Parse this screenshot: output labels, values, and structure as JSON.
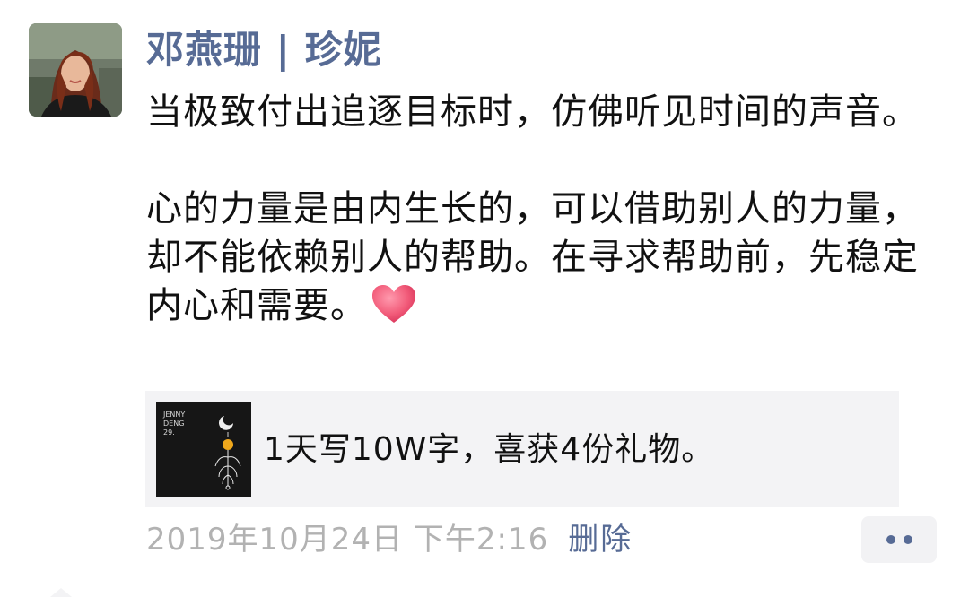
{
  "post": {
    "author": "邓燕珊 | 珍妮",
    "paragraph1": "当极致付出追逐目标时，仿佛听见时间的声音。",
    "paragraph2": "心的力量是由内生长的，可以借助别人的力量，却不能依赖别人的帮助。在寻求帮助前，先稳定内心和需要。",
    "heart_emoji": "heart-icon",
    "share_card": {
      "thumbnail_text": "JENNY\nDENG\n29.",
      "title": "1天写10W字，喜获4份礼物。"
    },
    "timestamp": "2019年10月24日 下午2:16",
    "delete_label": "删除",
    "more_icon": "more-dots-icon"
  },
  "colors": {
    "link_blue": "#576b95",
    "heart_pink": "#f25c7a",
    "timestamp_gray": "#b2b2b2",
    "card_bg": "#f3f3f5"
  }
}
